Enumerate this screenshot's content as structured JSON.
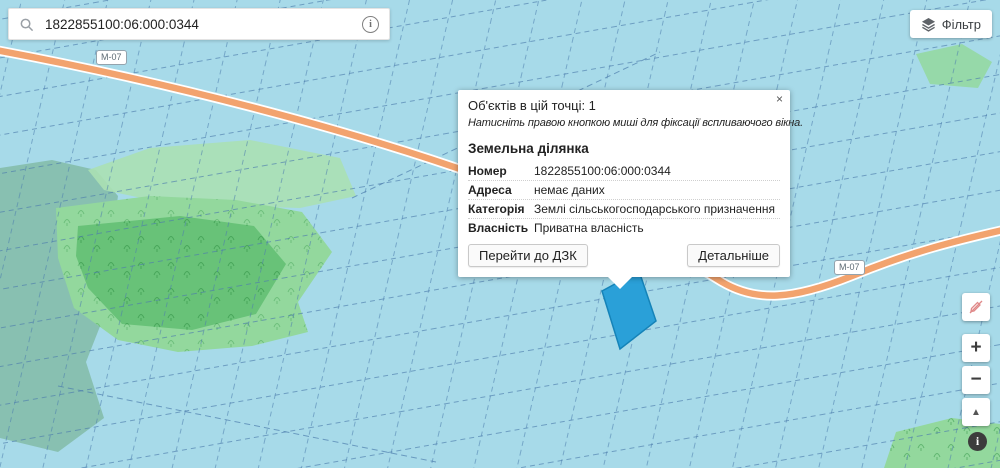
{
  "colors": {
    "map_base": "#a7dae9",
    "parcel_line": "#4d7dad",
    "road": "#f2a36e",
    "road_casing": "#ffffff",
    "forest": "#93d89d",
    "forest_dark": "#68c278",
    "forest_pale": "#abe0b4",
    "teal": "#86bfae",
    "tree_mark": "#3f9e52",
    "highlight_fill": "#2aa0d8",
    "highlight_stroke": "#1583b8"
  },
  "search": {
    "value": "1822855100:06:000:0344",
    "info_icon": "i"
  },
  "filter": {
    "label": "Фільтр"
  },
  "map": {
    "road_labels": [
      "М-07",
      "М-07"
    ]
  },
  "popup": {
    "close_icon": "×",
    "objects_line": "Об'єктів в цій точці: 1",
    "hint": "Натисніть правою кнопкою миші для фіксації вспливаючого вікна.",
    "section_title": "Земельна ділянка",
    "rows": [
      {
        "label": "Номер",
        "value": "1822855100:06:000:0344"
      },
      {
        "label": "Адреса",
        "value": "немає даних"
      },
      {
        "label": "Категорія",
        "value": "Землі сільськогосподарського призначення"
      },
      {
        "label": "Власність",
        "value": "Приватна власність"
      }
    ],
    "buttons": {
      "dzk": "Перейти до ДЗК",
      "details": "Детальніше"
    }
  },
  "controls": {
    "zoom_in": "+",
    "zoom_out": "−",
    "north": "▲",
    "info": "i"
  }
}
